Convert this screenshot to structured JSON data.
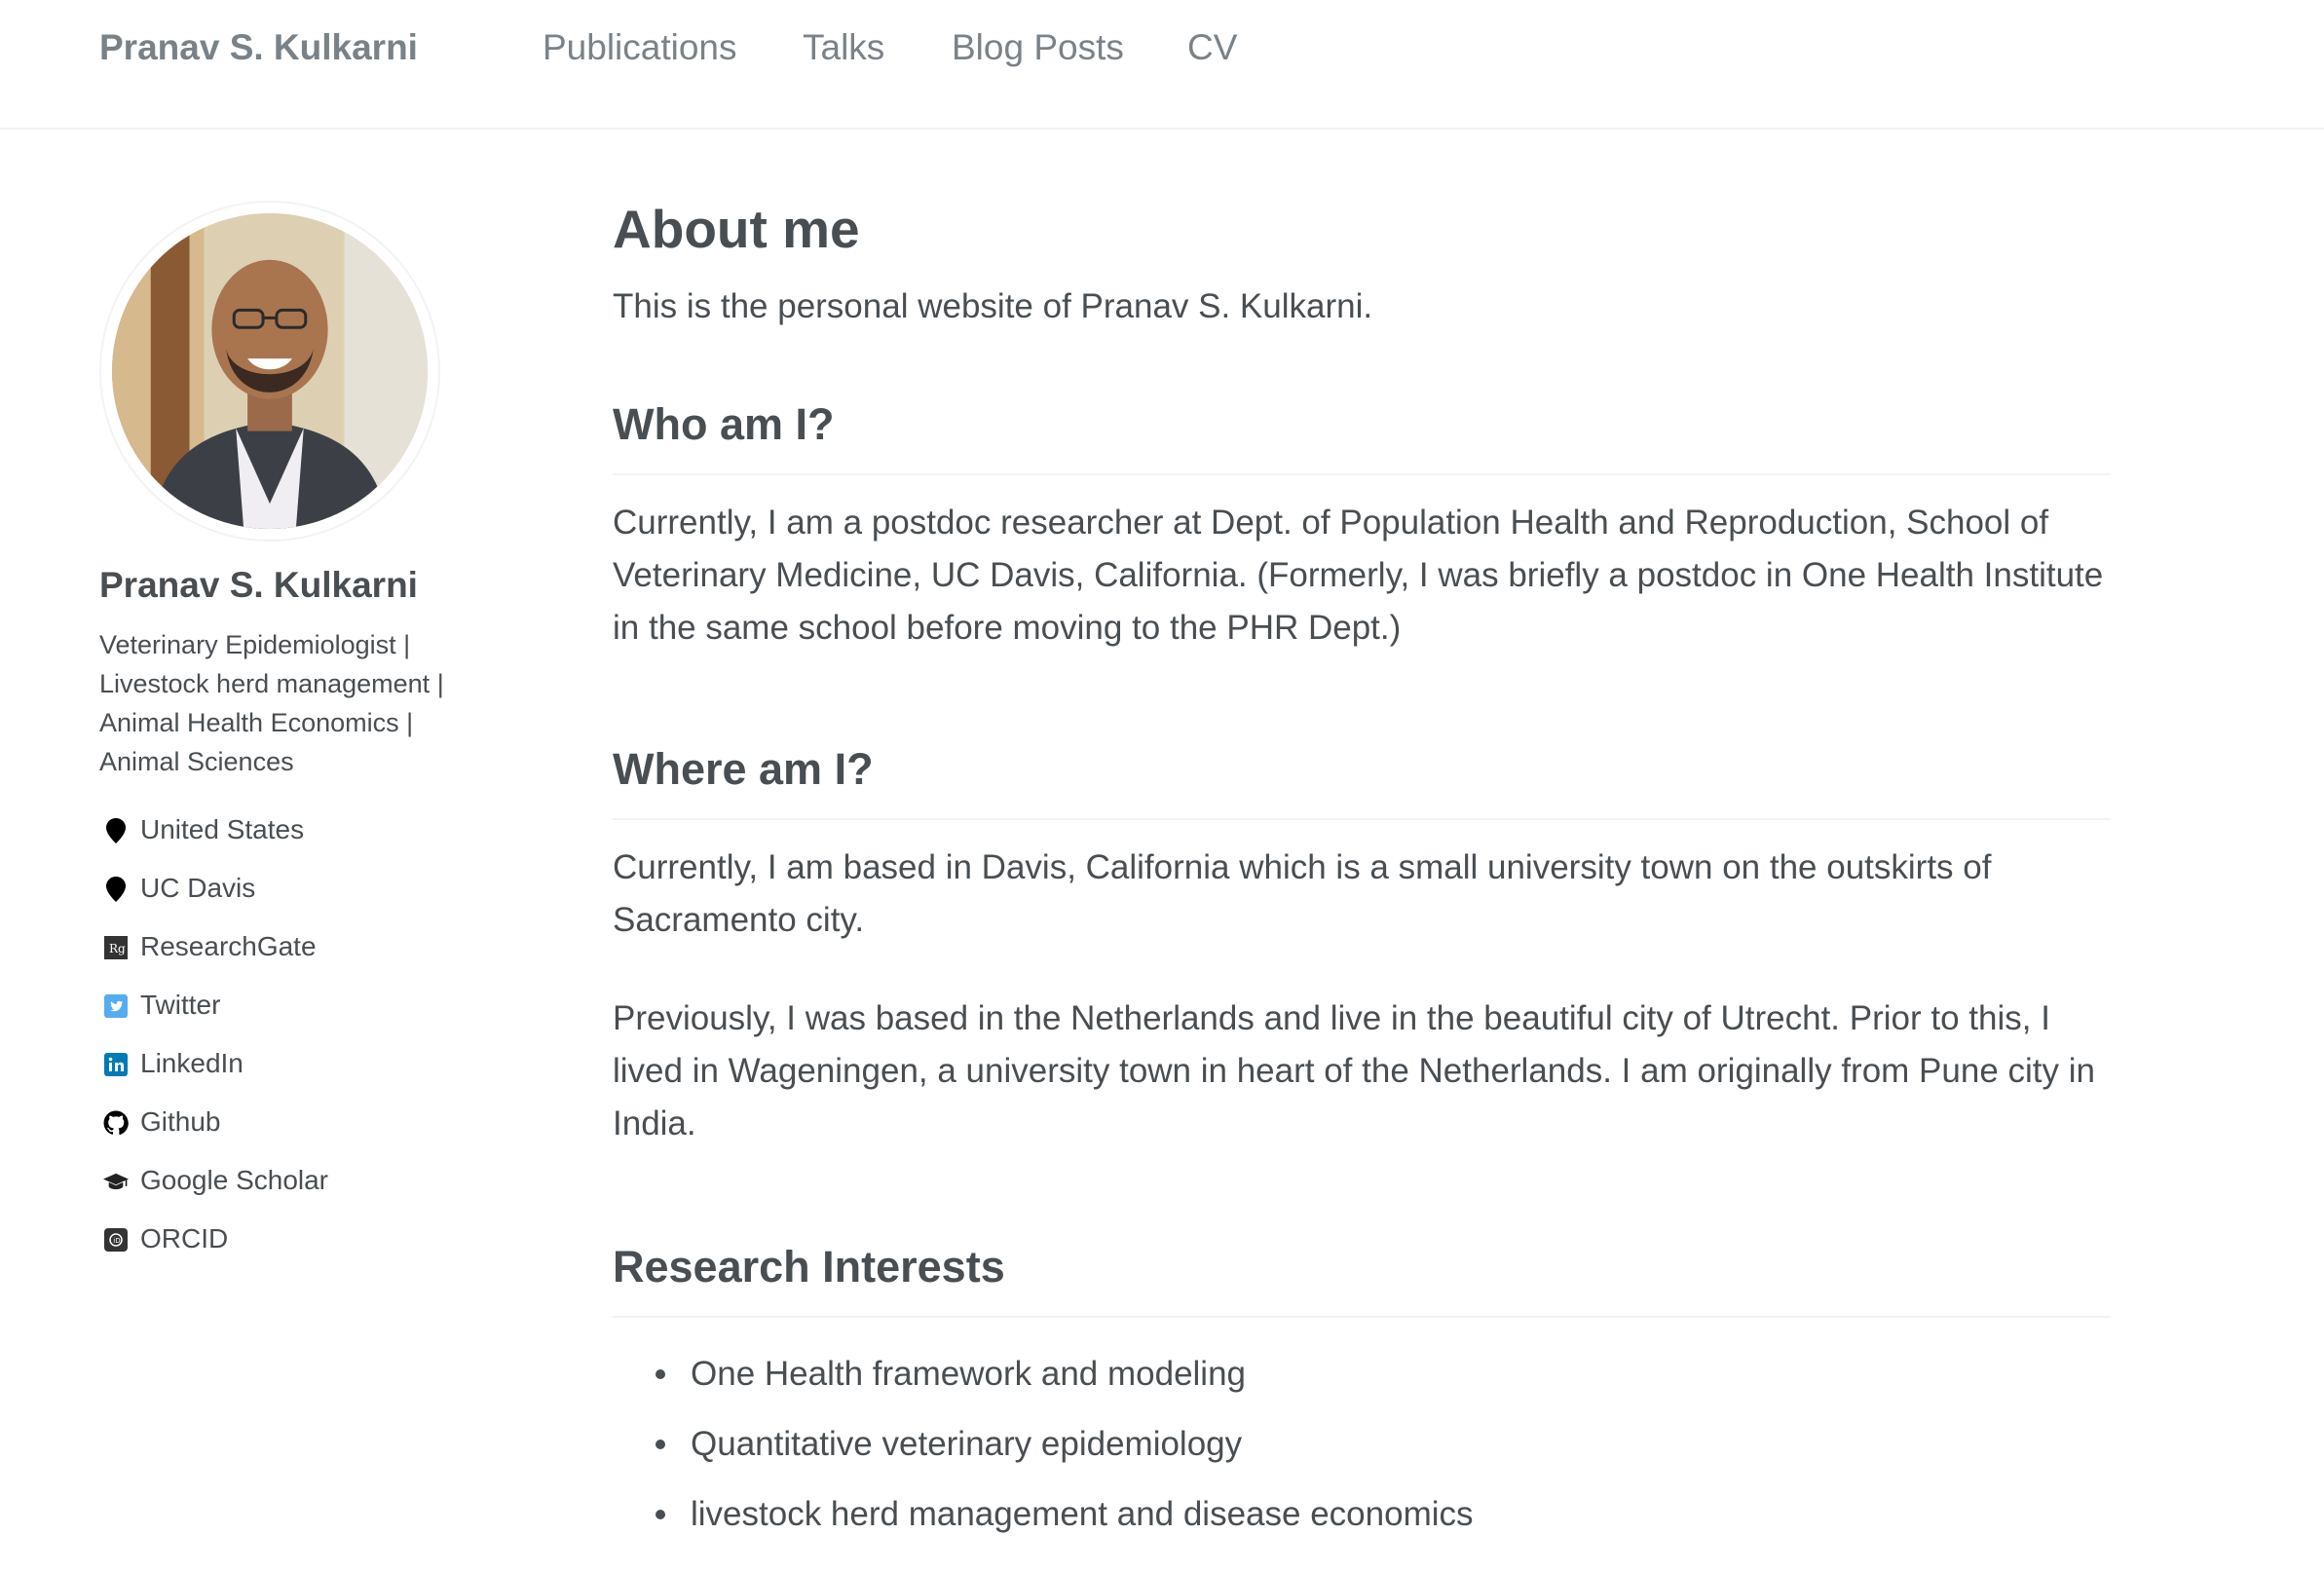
{
  "masthead": {
    "site_title": "Pranav S. Kulkarni",
    "nav": [
      {
        "label": "Publications"
      },
      {
        "label": "Talks"
      },
      {
        "label": "Blog Posts"
      },
      {
        "label": "CV"
      }
    ]
  },
  "sidebar": {
    "author_name": "Pranav S. Kulkarni",
    "bio": "Veterinary Epidemiologist | Livestock herd management | Animal Health Economics | Animal Sciences",
    "links": [
      {
        "label": "United States",
        "icon": "location-pin-icon"
      },
      {
        "label": "UC Davis",
        "icon": "location-pin-icon"
      },
      {
        "label": "ResearchGate",
        "icon": "researchgate-icon"
      },
      {
        "label": "Twitter",
        "icon": "twitter-icon",
        "color": "#55acee"
      },
      {
        "label": "LinkedIn",
        "icon": "linkedin-icon",
        "color": "#007bb6"
      },
      {
        "label": "Github",
        "icon": "github-icon"
      },
      {
        "label": "Google Scholar",
        "icon": "graduation-cap-icon"
      },
      {
        "label": "ORCID",
        "icon": "orcid-icon"
      }
    ]
  },
  "main": {
    "title": "About me",
    "intro": "This is the personal website of Pranav S. Kulkarni.",
    "sections": [
      {
        "heading": "Who am I?",
        "paragraphs": [
          "Currently, I am a postdoc researcher at Dept. of Population Health and Reproduction, School of Veterinary Medicine, UC Davis, California. (Formerly, I was briefly a postdoc in One Health Institute in the same school before moving to the PHR Dept.)"
        ]
      },
      {
        "heading": "Where am I?",
        "paragraphs": [
          "Currently, I am based in Davis, California which is a small university town on the outskirts of Sacramento city.",
          "Previously, I was based in the Netherlands and live in the beautiful city of Utrecht. Prior to this, I lived in Wageningen, a university town in heart of the Netherlands. I am originally from Pune city in India."
        ]
      },
      {
        "heading": "Research Interests",
        "items": [
          "One Health framework and modeling",
          "Quantitative veterinary epidemiology",
          "livestock herd management and disease economics"
        ]
      }
    ]
  }
}
